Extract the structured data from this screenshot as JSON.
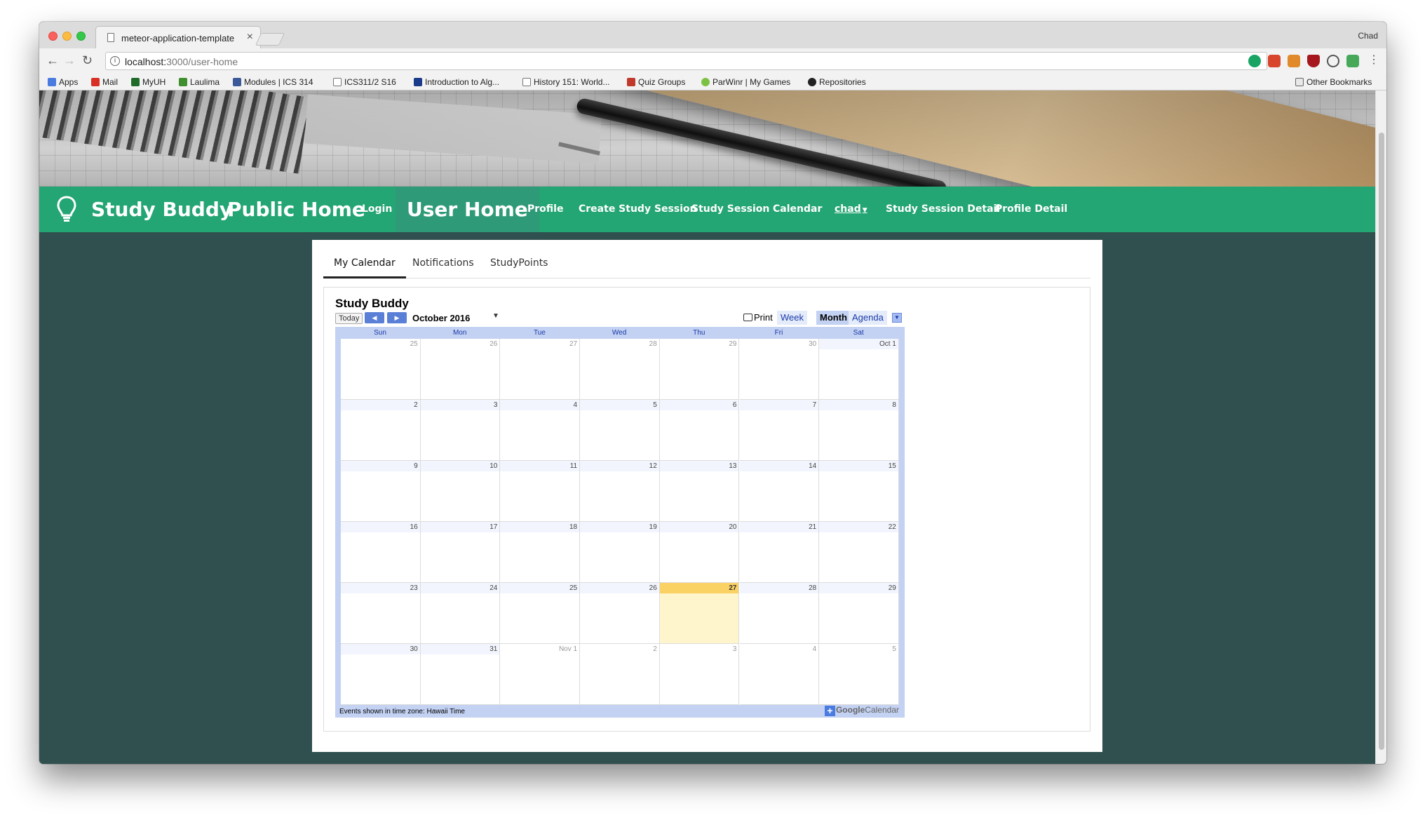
{
  "browser": {
    "tab_title": "meteor-application-template",
    "profile_name": "Chad",
    "url_host": "localhost:",
    "url_path": "3000/user-home",
    "bookmarks": [
      {
        "label": "Apps",
        "color": "#4a7be0"
      },
      {
        "label": "Mail",
        "color": "#d93025"
      },
      {
        "label": "MyUH",
        "color": "#1f6b2a"
      },
      {
        "label": "Laulima",
        "color": "#3f8f2e"
      },
      {
        "label": "Modules | ICS 314",
        "color": "#3b5998"
      },
      {
        "label": "ICS311/2 S16",
        "color": "#ffffff"
      },
      {
        "label": "Introduction to Alg...",
        "color": "#1a3a8a"
      },
      {
        "label": "History 151: World...",
        "color": "#ffffff"
      },
      {
        "label": "Quiz Groups",
        "color": "#c0392b"
      },
      {
        "label": "ParWinr | My Games",
        "color": "#7cc242"
      },
      {
        "label": "Repositories",
        "color": "#222222"
      }
    ],
    "other_bookmarks": "Other Bookmarks"
  },
  "navbar": {
    "brand": "Study Buddy",
    "public_home": "Public Home",
    "login": "Login",
    "user_home": "User Home",
    "profile": "Profile",
    "create_study_session": "Create Study Session",
    "study_session": "Study Session",
    "calendar": "Calendar",
    "user_menu": "chad",
    "study_session_detail": "Study Session Detail",
    "profile_detail": "Profile Detail",
    "bg_color": "#24a574"
  },
  "tabs": [
    "My Calendar",
    "Notifications",
    "StudyPoints"
  ],
  "calendar": {
    "title": "Study Buddy",
    "today_label": "Today",
    "month_label": "October 2016",
    "print_label": "Print",
    "views": [
      "Week",
      "Month",
      "Agenda"
    ],
    "active_view": "Month",
    "weekdays": [
      "Sun",
      "Mon",
      "Tue",
      "Wed",
      "Thu",
      "Fri",
      "Sat"
    ],
    "weeks": [
      [
        {
          "d": "25",
          "o": true
        },
        {
          "d": "26",
          "o": true
        },
        {
          "d": "27",
          "o": true
        },
        {
          "d": "28",
          "o": true
        },
        {
          "d": "29",
          "o": true
        },
        {
          "d": "30",
          "o": true
        },
        {
          "d": "Oct 1",
          "o": false
        }
      ],
      [
        {
          "d": "2"
        },
        {
          "d": "3"
        },
        {
          "d": "4"
        },
        {
          "d": "5"
        },
        {
          "d": "6"
        },
        {
          "d": "7"
        },
        {
          "d": "8"
        }
      ],
      [
        {
          "d": "9"
        },
        {
          "d": "10"
        },
        {
          "d": "11"
        },
        {
          "d": "12"
        },
        {
          "d": "13"
        },
        {
          "d": "14"
        },
        {
          "d": "15"
        }
      ],
      [
        {
          "d": "16"
        },
        {
          "d": "17"
        },
        {
          "d": "18"
        },
        {
          "d": "19"
        },
        {
          "d": "20"
        },
        {
          "d": "21"
        },
        {
          "d": "22"
        }
      ],
      [
        {
          "d": "23"
        },
        {
          "d": "24"
        },
        {
          "d": "25"
        },
        {
          "d": "26"
        },
        {
          "d": "27",
          "today": true
        },
        {
          "d": "28"
        },
        {
          "d": "29"
        }
      ],
      [
        {
          "d": "30"
        },
        {
          "d": "31"
        },
        {
          "d": "Nov 1",
          "o": true
        },
        {
          "d": "2",
          "o": true
        },
        {
          "d": "3",
          "o": true
        },
        {
          "d": "4",
          "o": true
        },
        {
          "d": "5",
          "o": true
        }
      ]
    ],
    "timezone_note": "Events shown in time zone: Hawaii Time",
    "footer_brand_google": "Google",
    "footer_brand_calendar": "Calendar"
  }
}
